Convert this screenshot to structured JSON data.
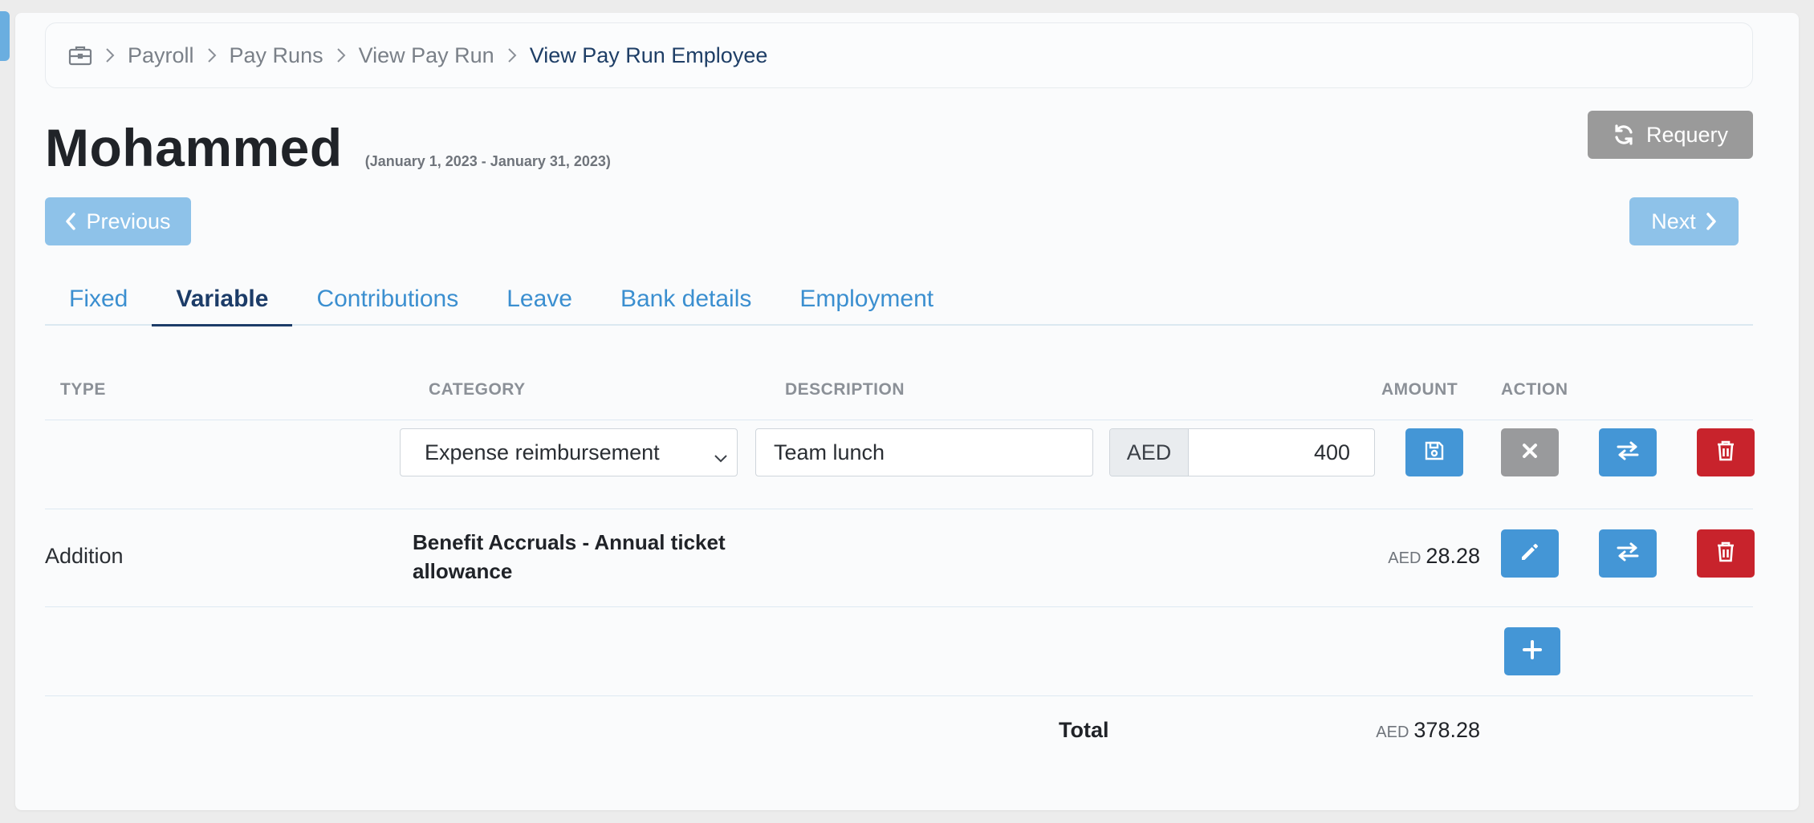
{
  "breadcrumb": {
    "items": [
      "Payroll",
      "Pay Runs",
      "View Pay Run"
    ],
    "current": "View Pay Run Employee"
  },
  "header": {
    "title": "Mohammed",
    "date_range": "(January 1, 2023 - January 31, 2023)",
    "requery_label": "Requery"
  },
  "nav": {
    "previous_label": "Previous",
    "next_label": "Next"
  },
  "tabs": [
    {
      "label": "Fixed",
      "active": false
    },
    {
      "label": "Variable",
      "active": true
    },
    {
      "label": "Contributions",
      "active": false
    },
    {
      "label": "Leave",
      "active": false
    },
    {
      "label": "Bank details",
      "active": false
    },
    {
      "label": "Employment",
      "active": false
    }
  ],
  "table": {
    "headers": {
      "type": "TYPE",
      "category": "CATEGORY",
      "description": "DESCRIPTION",
      "amount": "AMOUNT",
      "action": "ACTION"
    },
    "edit_row": {
      "category": "Expense reimbursement",
      "description": "Team lunch",
      "currency": "AED",
      "amount": "400"
    },
    "rows": [
      {
        "type": "Addition",
        "category": "Benefit Accruals - Annual ticket allowance",
        "currency": "AED",
        "amount": "28.28"
      }
    ],
    "total": {
      "label": "Total",
      "currency": "AED",
      "amount": "378.28"
    }
  },
  "colors": {
    "primary": "#4496d6",
    "danger": "#c8232c",
    "muted": "#999a9c",
    "nav_disabled": "#8ec2e9",
    "active_tab": "#1c3c68"
  },
  "icons": [
    "briefcase-icon",
    "chevron-right-icon",
    "refresh-icon",
    "chevron-left-icon",
    "save-icon",
    "close-icon",
    "swap-icon",
    "trash-icon",
    "pencil-icon",
    "plus-icon",
    "chevron-down-icon"
  ]
}
